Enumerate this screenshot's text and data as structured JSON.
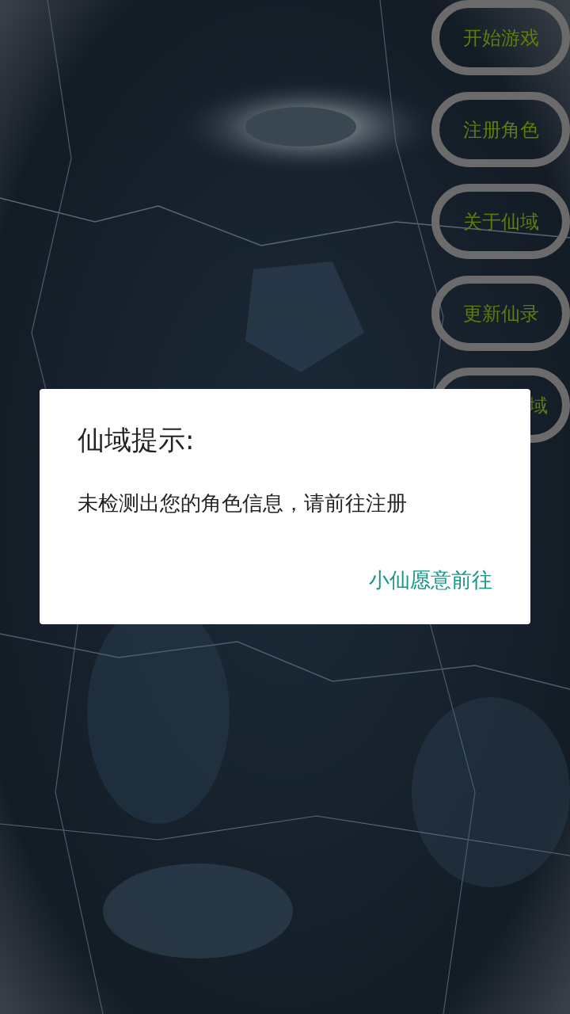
{
  "menu_buttons": [
    {
      "label": "开始游戏",
      "partially_covered": false
    },
    {
      "label": "注册角色",
      "partially_covered": false
    },
    {
      "label": "关于仙域",
      "partially_covered": false
    },
    {
      "label": "更新仙录",
      "partially_covered": false
    },
    {
      "label": "域",
      "partially_covered": true
    }
  ],
  "dialog": {
    "title": "仙域提示:",
    "message": "未检测出您的角色信息，请前往注册",
    "button": "小仙愿意前往"
  }
}
